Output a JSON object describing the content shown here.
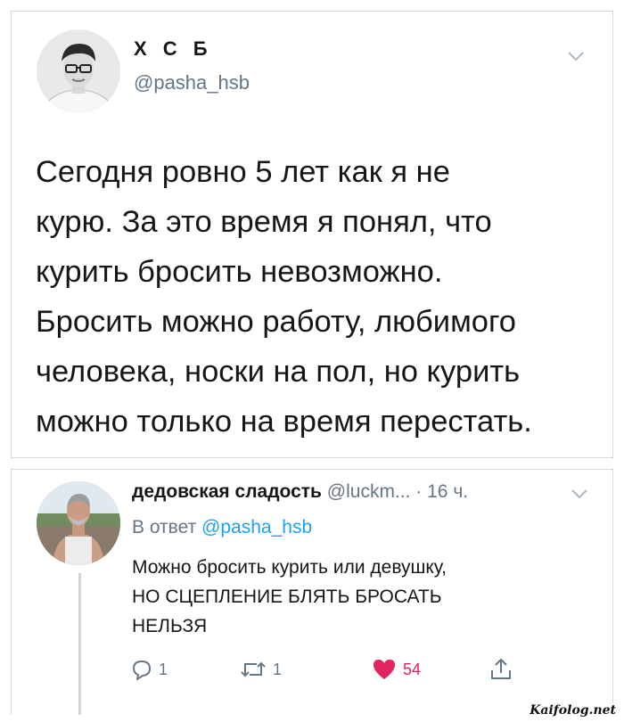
{
  "tweet_main": {
    "author_name": "Х С Б",
    "handle": "@pasha_hsb",
    "text": "Сегодня ровно 5 лет как я не\nкурю. За это время я понял, что\nкурить бросить невозможно.\nБросить можно работу, любимого\nчеловека, носки на пол, но курить\nможно только на время перестать."
  },
  "tweet_reply": {
    "author_name": "дедовская сладость",
    "handle_and_time": " @luckm... · 16 ч.",
    "reply_prefix": "В ответ ",
    "reply_to": "@pasha_hsb",
    "text": "Можно бросить курить или девушку,\nНО СЦЕПЛЕНИЕ БЛЯТЬ БРОСАТЬ\nНЕЛЬЗЯ",
    "actions": {
      "reply_count": "1",
      "retweet_count": "1",
      "like_count": "54"
    }
  },
  "colors": {
    "like": "#e0245e",
    "link": "#1da1f2",
    "muted": "#657786"
  },
  "watermark": "Kaifolog.net"
}
